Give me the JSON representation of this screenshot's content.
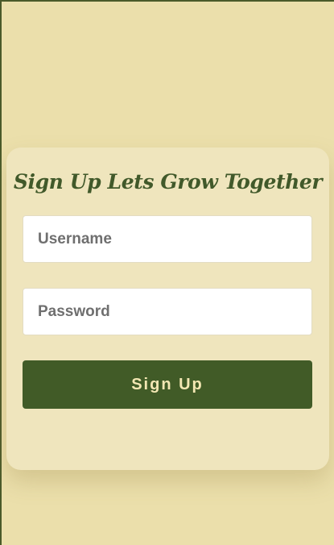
{
  "signup_form": {
    "title": "Sign Up Lets Grow Together",
    "username": {
      "value": "",
      "placeholder": "Username"
    },
    "password": {
      "value": "",
      "placeholder": "Password"
    },
    "submit_label": "Sign Up"
  },
  "colors": {
    "page_background": "#ebdfab",
    "card_background": "#efe5bd",
    "accent_green": "#415b27",
    "button_text": "#f3e7b3"
  }
}
